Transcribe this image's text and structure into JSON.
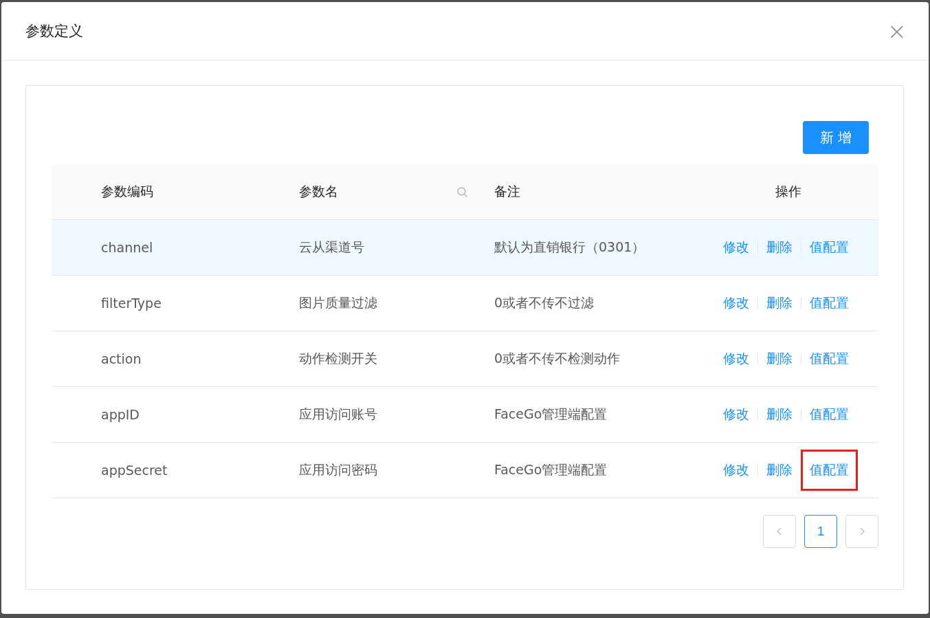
{
  "dialog": {
    "title": "参数定义",
    "close": "×"
  },
  "add_button": "新 增",
  "table": {
    "columns": [
      {
        "label": "参数编码",
        "kind": "plain"
      },
      {
        "label": "参数名",
        "kind": "searchable"
      },
      {
        "label": "备注",
        "kind": "plain"
      },
      {
        "label": "操作",
        "kind": "plain"
      }
    ],
    "rows": [
      {
        "code": "channel",
        "name": "云从渠道号",
        "note": "默认为直销银行（0301）",
        "hovered": true,
        "actions": [
          {
            "label": "修改",
            "highlighted": false
          },
          {
            "label": "删除",
            "highlighted": false
          },
          {
            "label": "值配置",
            "highlighted": false
          }
        ]
      },
      {
        "code": "filterType",
        "name": "图片质量过滤",
        "note": "0或者不传不过滤",
        "hovered": false,
        "actions": [
          {
            "label": "修改",
            "highlighted": false
          },
          {
            "label": "删除",
            "highlighted": false
          },
          {
            "label": "值配置",
            "highlighted": false
          }
        ]
      },
      {
        "code": "action",
        "name": "动作检测开关",
        "note": "0或者不传不检测动作",
        "hovered": false,
        "actions": [
          {
            "label": "修改",
            "highlighted": false
          },
          {
            "label": "删除",
            "highlighted": false
          },
          {
            "label": "值配置",
            "highlighted": false
          }
        ]
      },
      {
        "code": "appID",
        "name": "应用访问账号",
        "note": "FaceGo管理端配置",
        "hovered": false,
        "actions": [
          {
            "label": "修改",
            "highlighted": false
          },
          {
            "label": "删除",
            "highlighted": false
          },
          {
            "label": "值配置",
            "highlighted": false
          }
        ]
      },
      {
        "code": "appSecret",
        "name": "应用访问密码",
        "note": "FaceGo管理端配置",
        "hovered": false,
        "actions": [
          {
            "label": "修改",
            "highlighted": false
          },
          {
            "label": "删除",
            "highlighted": false
          },
          {
            "label": "值配置",
            "highlighted": true
          }
        ]
      }
    ]
  },
  "pagination": {
    "prev_disabled": true,
    "next_disabled": true,
    "pages": [
      {
        "label": "1",
        "selected": true
      }
    ]
  }
}
